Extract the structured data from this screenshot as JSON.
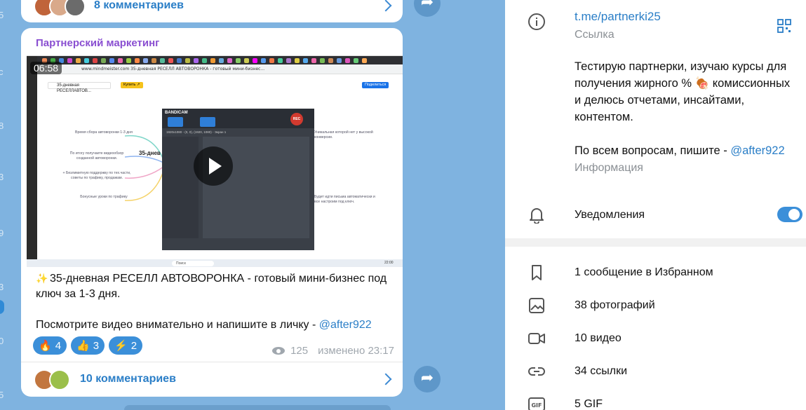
{
  "feed": {
    "edge_numbers": [
      "5",
      "с",
      "8",
      "3",
      "9",
      "3",
      "0",
      "5"
    ],
    "top_post": {
      "comments_label": "8 комментариев"
    },
    "post": {
      "channel_name": "Партнерский маркетинг",
      "video": {
        "timecode": "06:58",
        "url": "www.mindmeister.com  35-дневная РЕСЕЛЛ АВТОВОРОНКА - готовый мини-бизнес...",
        "tab_label": "35-дневная РЕСЕЛЛАВТОВ...",
        "buy_label": "Купить ↗",
        "share_label": "Поделиться",
        "center_node": "35-днев",
        "nodes": [
          "Время сбора автоворонки 1-3 дня",
          "По итогу получаете видеообзор созданной автоворонки.",
          "+ Безлимитную поддержку по тех.части, советы по трафику, продажам.",
          "Бонусные уроки по трафику",
          "Уникальная которой нет у высокой конверсии.",
          "Будет идти письма автоматически и все настроим под ключ."
        ],
        "bandicam": {
          "title": "BANDICAM",
          "rec_label": "REC",
          "resolution": "1920x1080 - (0, 0), (1920, 1080) - Экран 1"
        },
        "taskbar": {
          "search": "Поиск",
          "time": "22:00"
        }
      },
      "text_line1": "35-дневная РЕСЕЛЛ АВТОВОРОНКА - готовый мини-бизнес под ключ за 1-3 дня.",
      "text_line2": "Посмотрите видео внимательно и напишите в личку - ",
      "text_mention": "@after922",
      "reactions": [
        {
          "emoji": "🔥",
          "count": "4"
        },
        {
          "emoji": "👍",
          "count": "3"
        },
        {
          "emoji": "⚡",
          "count": "2"
        }
      ],
      "views": "125",
      "edited": "изменено 23:17",
      "comments_label": "10 комментариев"
    }
  },
  "info": {
    "link": "t.me/partnerki25",
    "link_caption": "Ссылка",
    "description": "Тестирую партнерки, изучаю курсы для получения жирного % 🍖 комиссионных и делюсь отчетами, инсайтами, контентом.",
    "contact_prefix": "По всем вопросам, пишите - ",
    "contact_mention": "@after922",
    "description_caption": "Информация",
    "notifications_label": "Уведомления",
    "notifications_on": true,
    "media": [
      {
        "icon": "bookmark-icon",
        "label": "1 сообщение в Избранном"
      },
      {
        "icon": "photo-icon",
        "label": "38 фотографий"
      },
      {
        "icon": "video-icon",
        "label": "10 видео"
      },
      {
        "icon": "link-icon",
        "label": "34 ссылки"
      },
      {
        "icon": "gif-icon",
        "label": "5 GIF"
      }
    ]
  },
  "colors": {
    "accent": "#2a7ec7",
    "channel": "#8a4fd1",
    "reaction": "#3b8fd9",
    "background": "#7fb3e0"
  }
}
